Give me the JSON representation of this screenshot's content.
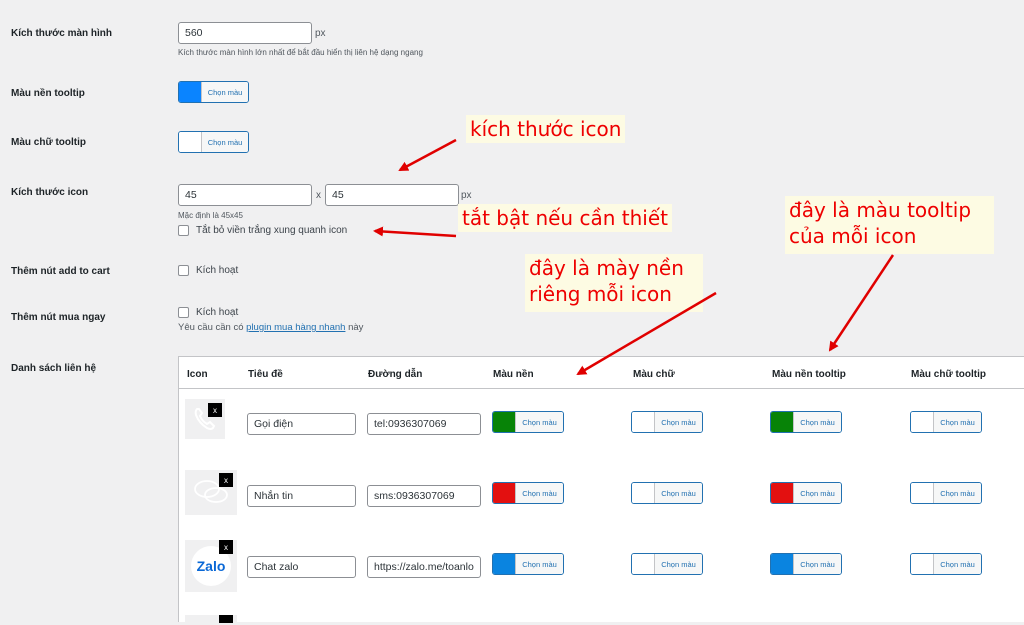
{
  "settings": {
    "screen_size": {
      "label": "Kích thước màn hình",
      "value": "560",
      "unit": "px",
      "help": "Kích thước màn hình lớn nhất để bắt đầu hiển thị liên hệ dạng ngang"
    },
    "tooltip_bg": {
      "label": "Màu nền tooltip",
      "button": "Chọn màu",
      "color": "#0a84ff"
    },
    "tooltip_text": {
      "label": "Màu chữ tooltip",
      "button": "Chọn màu",
      "color": "#ffffff"
    },
    "icon_size": {
      "label": "Kích thước icon",
      "width": "45",
      "sep": "x",
      "height": "45",
      "unit": "px",
      "help": "Mặc định là 45x45",
      "checkbox": "Tắt bỏ viền trắng xung quanh icon"
    },
    "add_to_cart": {
      "label": "Thêm nút add to cart",
      "checkbox": "Kích hoạt"
    },
    "buy_now": {
      "label": "Thêm nút mua ngay",
      "checkbox": "Kích hoạt",
      "note_prefix": "Yêu cầu cần có",
      "note_link": "plugin mua hàng nhanh",
      "note_suffix": "này"
    },
    "contact_list": {
      "label": "Danh sách liên hệ"
    }
  },
  "table": {
    "headers": {
      "icon": "Icon",
      "title": "Tiêu đề",
      "path": "Đường dẫn",
      "bg": "Màu nền",
      "text": "Màu chữ",
      "tooltip_bg": "Màu nền tooltip",
      "tooltip_text": "Màu chữ tooltip"
    },
    "button_label": "Chọn màu",
    "remove_label": "x",
    "rows": [
      {
        "icon": "phone-icon",
        "title": "Gọi điện",
        "path": "tel:0936307069",
        "bg": "#078307",
        "text": "#ffffff",
        "tooltip_bg": "#078307",
        "tooltip_text": "#ffffff"
      },
      {
        "icon": "chat-icon",
        "title": "Nhắn tin",
        "path": "sms:0936307069",
        "bg": "#e31010",
        "text": "#ffffff",
        "tooltip_bg": "#e31010",
        "tooltip_text": "#ffffff"
      },
      {
        "icon": "zalo-icon",
        "icon_text": "Zalo",
        "title": "Chat zalo",
        "path": "https://zalo.me/toanlo",
        "bg": "#0a84e0",
        "text": "#ffffff",
        "tooltip_bg": "#0a84e0",
        "tooltip_text": "#ffffff"
      }
    ]
  },
  "annotations": {
    "icon_size": "kích thước icon",
    "toggle": "tắt bật nếu cần thiết",
    "tooltip_line1": "đây là màu tooltip",
    "tooltip_line2": "của mỗi icon",
    "bg_line1": "đây là mày nền",
    "bg_line2": "riêng mỗi icon",
    "color": "#e00000"
  }
}
